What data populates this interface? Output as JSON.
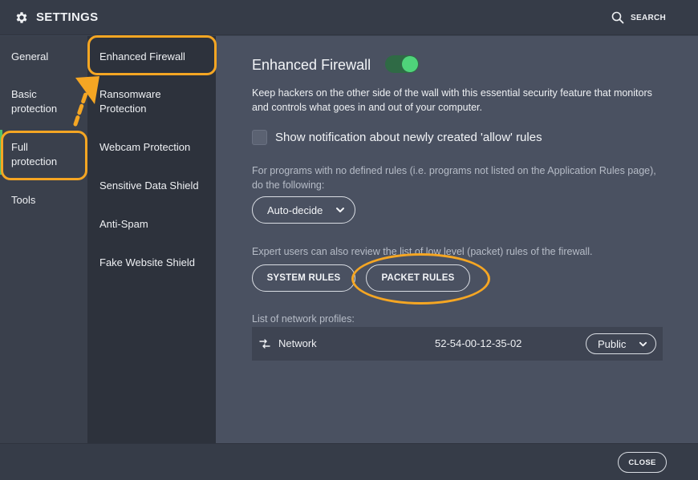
{
  "header": {
    "title": "SETTINGS",
    "search_label": "SEARCH"
  },
  "nav_primary": {
    "items": [
      {
        "label": "General"
      },
      {
        "label": "Basic\nprotection"
      },
      {
        "label": "Full\nprotection",
        "active": true
      },
      {
        "label": "Tools"
      }
    ]
  },
  "nav_secondary": {
    "items": [
      {
        "label": "Enhanced Firewall",
        "active": true
      },
      {
        "label": "Ransomware\nProtection"
      },
      {
        "label": "Webcam Protection"
      },
      {
        "label": "Sensitive Data Shield"
      },
      {
        "label": "Anti-Spam"
      },
      {
        "label": "Fake Website Shield"
      }
    ]
  },
  "main": {
    "title": "Enhanced Firewall",
    "toggle_on": true,
    "description": "Keep hackers on the other side of the wall with this essential security feature that monitors and controls what goes in and out of your computer.",
    "checkbox_label": "Show notification about newly created 'allow' rules",
    "checkbox_checked": false,
    "no_rules_text": "For programs with no defined rules (i.e. programs not listed on the Application Rules page), do the following:",
    "dropdown_value": "Auto-decide",
    "expert_text": "Expert users can also review the list of low level (packet) rules of the firewall.",
    "system_rules_label": "SYSTEM RULES",
    "packet_rules_label": "PACKET RULES",
    "profiles_label": "List of network profiles:",
    "profiles": [
      {
        "name": "Network",
        "mac": "52-54-00-12-35-02",
        "type": "Public"
      }
    ]
  },
  "footer": {
    "close_label": "CLOSE"
  },
  "colors": {
    "accent_green": "#4fd37a",
    "annotation_orange": "#f5a623"
  },
  "icons": [
    "gear-icon",
    "search-icon",
    "chevron-down-icon",
    "network-icon"
  ]
}
